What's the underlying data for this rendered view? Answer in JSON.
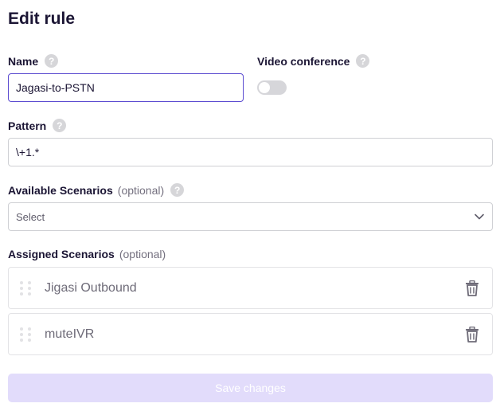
{
  "title": "Edit rule",
  "name_field": {
    "label": "Name",
    "value": "Jagasi-to-PSTN"
  },
  "video_conference": {
    "label": "Video conference",
    "enabled": false
  },
  "pattern_field": {
    "label": "Pattern",
    "value": "\\+1.*"
  },
  "available_scenarios": {
    "label": "Available Scenarios",
    "optional": "(optional)",
    "placeholder": "Select"
  },
  "assigned_scenarios": {
    "label": "Assigned Scenarios",
    "optional": "(optional)",
    "items": [
      {
        "name": "Jigasi Outbound"
      },
      {
        "name": "muteIVR"
      }
    ]
  },
  "help_glyph": "?",
  "save_button": {
    "label": "Save changes",
    "enabled": false
  },
  "icons": [
    "help-icon",
    "chevron-down-icon",
    "drag-handle-icon",
    "trash-icon"
  ],
  "colors": {
    "accent": "#5b4bd0",
    "save_disabled_bg": "#e2dcfb"
  }
}
